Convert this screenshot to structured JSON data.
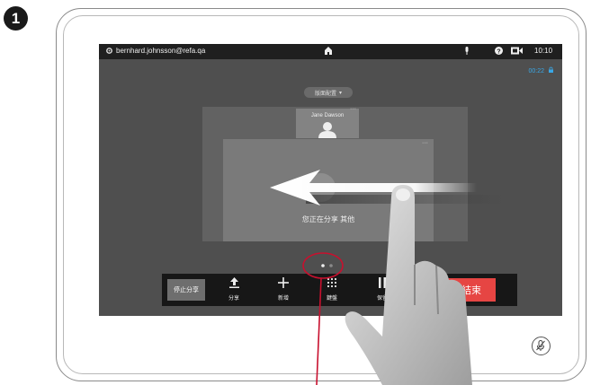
{
  "step": {
    "number": "1"
  },
  "status": {
    "user": "bernhard.johnsson@refa.qa",
    "time": "10:10"
  },
  "call": {
    "timer": "00:22",
    "layout_label": "版面配置"
  },
  "participant": {
    "name": "Jane Dawson"
  },
  "share": {
    "message": "您正在分享 其他"
  },
  "toolbar": {
    "stop_share": "停止分享",
    "share": "分享",
    "add": "新增",
    "keypad": "鍵盤",
    "hold": "保留",
    "end": "結束"
  },
  "icons": [
    "gear-icon",
    "home-icon",
    "microphone-icon",
    "help-icon",
    "camera-icon",
    "lock-icon",
    "user-icon",
    "upload-icon",
    "plus-icon",
    "keypad-icon",
    "pause-icon",
    "mute-icon",
    "hand-icon",
    "arrow-left-icon"
  ],
  "colors": {
    "accent": "#39a7e6",
    "end_call": "#e64543",
    "highlight": "#c8102e"
  }
}
